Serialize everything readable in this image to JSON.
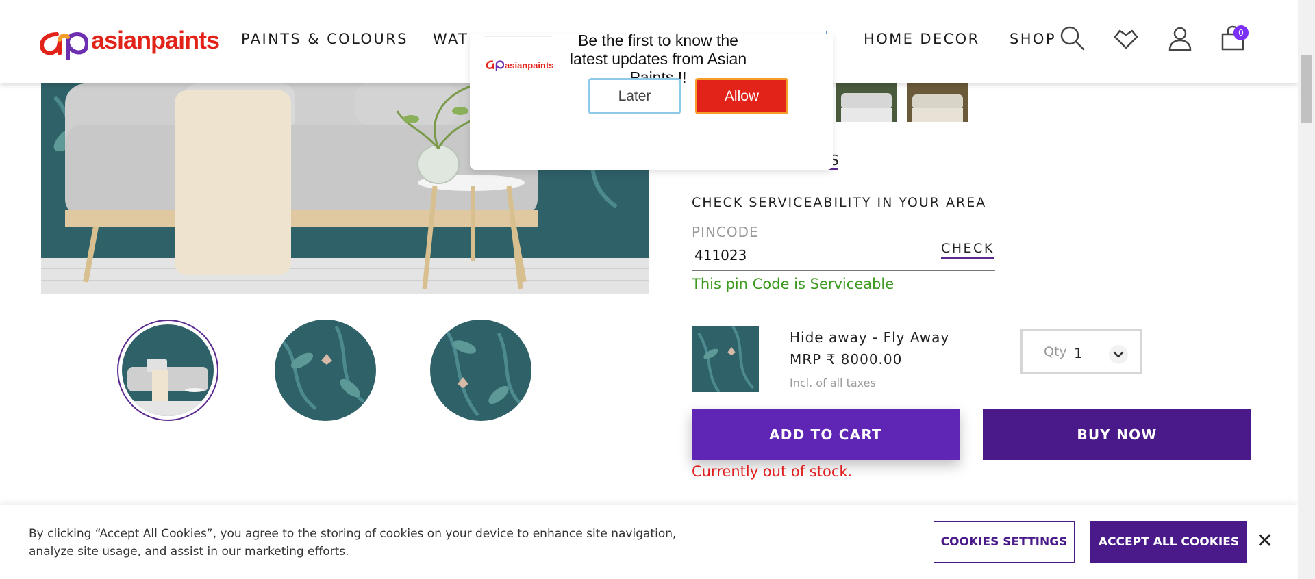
{
  "header": {
    "logo_text": "asianpaints",
    "nav": [
      "PAINTS & COLOURS",
      "WAT",
      "HOME DECOR",
      "SHOP"
    ],
    "cart_count": "0"
  },
  "notification": {
    "logo_text": "asianpaints",
    "message": "Be the first to know the latest updates from Asian Paints !!",
    "later_label": "Later",
    "allow_label": "Allow"
  },
  "product_tab": {
    "label_fragment": "S"
  },
  "serviceability": {
    "title": "CHECK SERVICEABILITY IN YOUR AREA",
    "pincode_label": "PINCODE",
    "pincode_value": "411023",
    "check_label": "CHECK",
    "status": "This pin Code is Serviceable"
  },
  "product": {
    "name": "Hide away - Fly Away",
    "price": "MRP ₹ 8000.00",
    "tax_note": "Incl. of all taxes",
    "qty_label": "Qty",
    "qty_value": "1"
  },
  "actions": {
    "add_to_cart": "ADD TO CART",
    "buy_now": "BUY NOW",
    "stock_status": "Currently out of stock."
  },
  "cookie": {
    "text": "By clicking “Accept All Cookies”, you agree to the storing of cookies on your device to enhance site navigation, analyze site usage, and assist in our marketing efforts.",
    "settings_label": "COOKIES SETTINGS",
    "accept_label": "ACCEPT ALL COOKIES",
    "close_symbol": "✕"
  },
  "colors": {
    "brand_red": "#e2231a",
    "primary_purple": "#5f25b5",
    "dark_purple": "#4a1a8a",
    "wallpaper_teal": "#2f6168",
    "success_green": "#3c9a1f",
    "error_red": "#e02020"
  }
}
